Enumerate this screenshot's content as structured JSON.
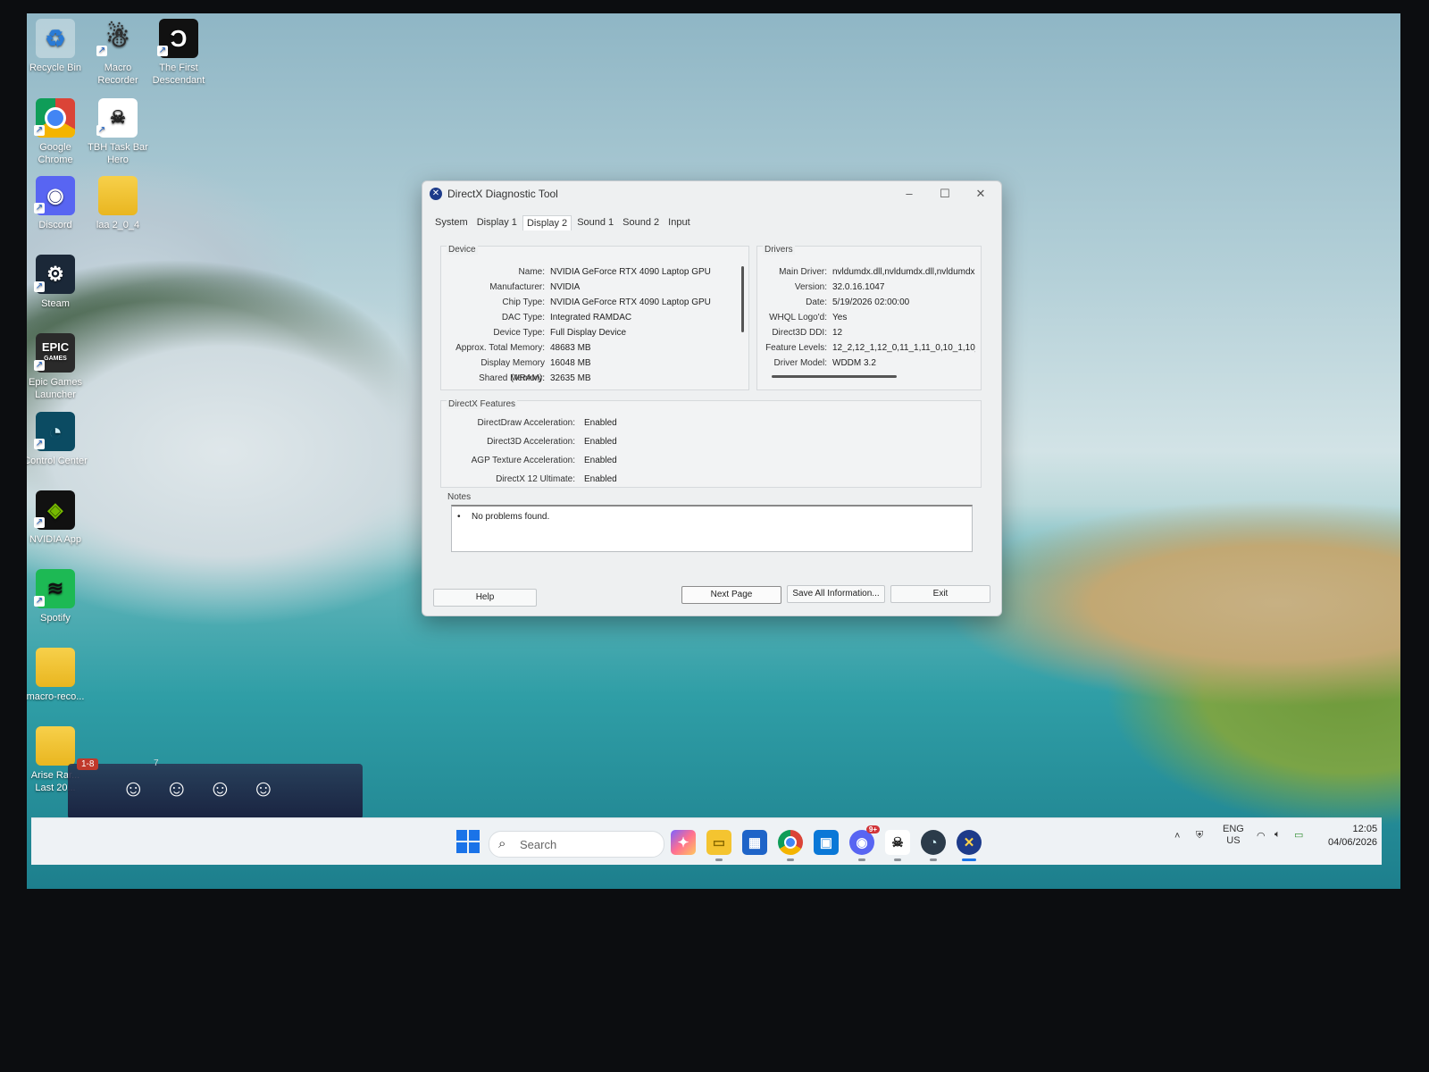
{
  "desktop": {
    "icons": [
      {
        "label": "Recycle Bin"
      },
      {
        "label": "Macro Recorder"
      },
      {
        "label": "The First Descendant"
      },
      {
        "label": "Google Chrome"
      },
      {
        "label": "TBH Task Bar Hero"
      },
      {
        "label": "Discord"
      },
      {
        "label": "laa 2_0_4"
      },
      {
        "label": "Steam"
      },
      {
        "label": "Epic Games Launcher"
      },
      {
        "label": "Control Center"
      },
      {
        "label": "NVIDIA App"
      },
      {
        "label": "Spotify"
      },
      {
        "label": "macro-reco..."
      },
      {
        "label": "Arise Rar... Last 20..."
      }
    ],
    "epic_logo": "EPIC",
    "epic_sub": "GAMES",
    "game_widget": {
      "level": "1-8",
      "count": "7"
    }
  },
  "window": {
    "title": "DirectX Diagnostic Tool",
    "tabs": [
      "System",
      "Display 1",
      "Display 2",
      "Sound 1",
      "Sound 2",
      "Input"
    ],
    "active_tab": "Display 2",
    "device": {
      "label": "Device",
      "rows": [
        {
          "k": "Name:",
          "v": "NVIDIA GeForce RTX 4090 Laptop GPU"
        },
        {
          "k": "Manufacturer:",
          "v": "NVIDIA"
        },
        {
          "k": "Chip Type:",
          "v": "NVIDIA GeForce RTX 4090 Laptop GPU"
        },
        {
          "k": "DAC Type:",
          "v": "Integrated RAMDAC"
        },
        {
          "k": "Device Type:",
          "v": "Full Display Device"
        },
        {
          "k": "Approx. Total Memory:",
          "v": "48683 MB"
        },
        {
          "k": "Display Memory (VRAM):",
          "v": "16048 MB"
        },
        {
          "k": "Shared Memory:",
          "v": "32635 MB"
        }
      ]
    },
    "drivers": {
      "label": "Drivers",
      "rows": [
        {
          "k": "Main Driver:",
          "v": "nvldumdx.dll,nvldumdx.dll,nvldumdx.d"
        },
        {
          "k": "Version:",
          "v": "32.0.16.1047"
        },
        {
          "k": "Date:",
          "v": "5/19/2026 02:00:00"
        },
        {
          "k": "WHQL Logo'd:",
          "v": "Yes"
        },
        {
          "k": "Direct3D DDI:",
          "v": "12"
        },
        {
          "k": "Feature Levels:",
          "v": "12_2,12_1,12_0,11_1,11_0,10_1,10_("
        },
        {
          "k": "Driver Model:",
          "v": "WDDM 3.2"
        }
      ]
    },
    "features": {
      "label": "DirectX Features",
      "rows": [
        {
          "k": "DirectDraw Acceleration:",
          "v": "Enabled"
        },
        {
          "k": "Direct3D Acceleration:",
          "v": "Enabled"
        },
        {
          "k": "AGP Texture Acceleration:",
          "v": "Enabled"
        },
        {
          "k": "DirectX 12 Ultimate:",
          "v": "Enabled"
        }
      ]
    },
    "notes": {
      "label": "Notes",
      "bullet": "•",
      "message": "No problems found."
    },
    "buttons": {
      "help": "Help",
      "next": "Next Page",
      "save": "Save All Information...",
      "exit": "Exit"
    }
  },
  "taskbar": {
    "search_placeholder": "Search",
    "discord_badge": "9+",
    "lang_top": "ENG",
    "lang_bottom": "US",
    "time": "12:05",
    "date": "04/06/2026"
  },
  "colors": {
    "accent": "#1a73e8",
    "window_bg": "#eef0f1"
  }
}
